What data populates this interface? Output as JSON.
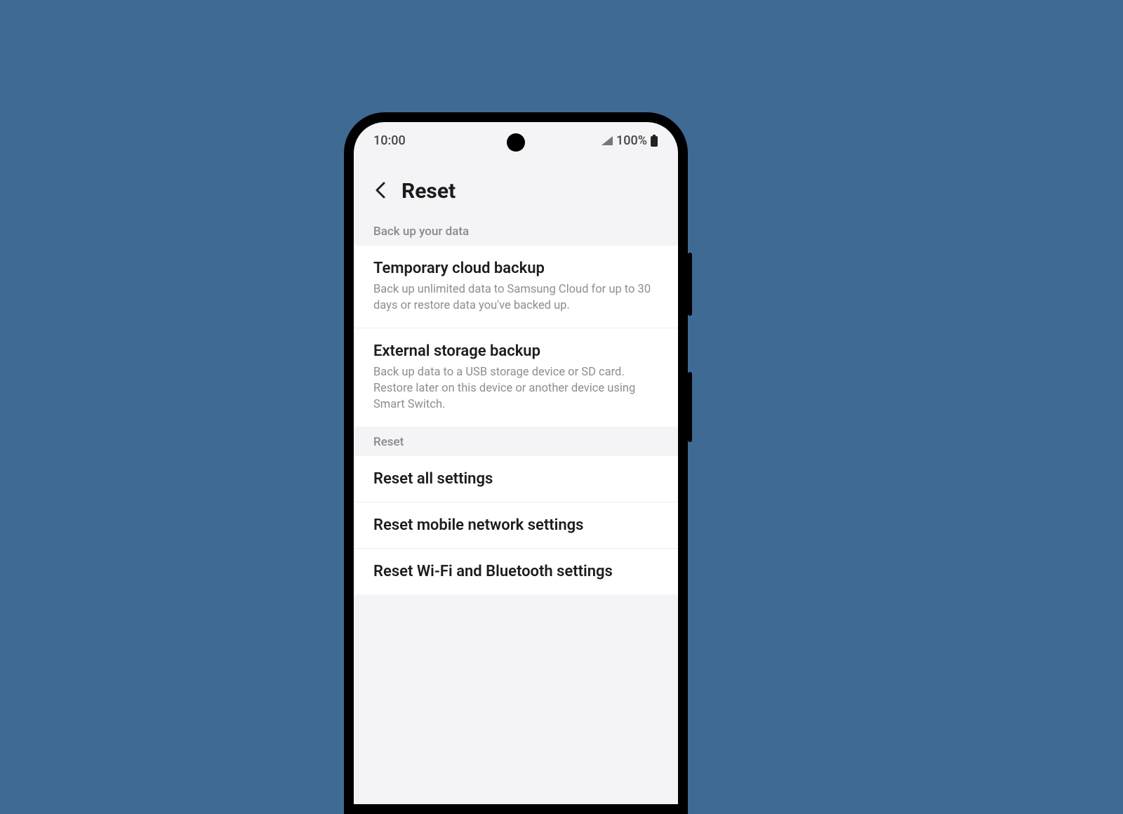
{
  "status": {
    "time": "10:00",
    "battery_text": "100%"
  },
  "header": {
    "title": "Reset"
  },
  "sections": {
    "backup_label": "Back up your data",
    "reset_label": "Reset"
  },
  "backup": {
    "cloud": {
      "title": "Temporary cloud backup",
      "subtitle": "Back up unlimited data to Samsung Cloud for up to 30 days or restore data you've backed up."
    },
    "external": {
      "title": "External storage backup",
      "subtitle": "Back up data to a USB storage device or SD card. Restore later on this device or another device using Smart Switch."
    }
  },
  "reset": {
    "all": {
      "title": "Reset all settings"
    },
    "network": {
      "title": "Reset mobile network settings"
    },
    "wifi_bt": {
      "title": "Reset Wi-Fi and Bluetooth settings"
    }
  }
}
